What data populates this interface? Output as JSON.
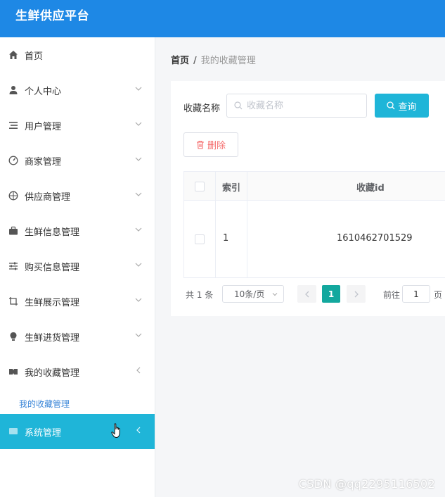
{
  "app": {
    "title": "生鲜供应平台"
  },
  "sidebar": {
    "items": [
      {
        "label": "首页",
        "icon": "home-icon",
        "chevron": ""
      },
      {
        "label": "个人中心",
        "icon": "user-icon",
        "chevron": "down"
      },
      {
        "label": "用户管理",
        "icon": "list-icon",
        "chevron": "down"
      },
      {
        "label": "商家管理",
        "icon": "compass-icon",
        "chevron": "down"
      },
      {
        "label": "供应商管理",
        "icon": "target-icon",
        "chevron": "down"
      },
      {
        "label": "生鲜信息管理",
        "icon": "briefcase-icon",
        "chevron": "down"
      },
      {
        "label": "购买信息管理",
        "icon": "sliders-icon",
        "chevron": "down"
      },
      {
        "label": "生鲜展示管理",
        "icon": "crop-icon",
        "chevron": "down"
      },
      {
        "label": "生鲜进货管理",
        "icon": "bulb-icon",
        "chevron": "down"
      },
      {
        "label": "我的收藏管理",
        "icon": "ticket-icon",
        "chevron": "left"
      }
    ],
    "sub_item": "我的收藏管理",
    "active_item": {
      "label": "系统管理",
      "icon": "system-icon"
    }
  },
  "breadcrumb": {
    "home": "首页",
    "separator": "/",
    "current": "我的收藏管理"
  },
  "search": {
    "label": "收藏名称",
    "placeholder": "收藏名称",
    "query_label": "查询"
  },
  "toolbar": {
    "delete_label": "删除"
  },
  "table": {
    "headers": [
      "索引",
      "收藏id"
    ],
    "rows": [
      {
        "index": "1",
        "id": "1610462701529"
      }
    ]
  },
  "pagination": {
    "total": "共 1 条",
    "page_size": "10条/页",
    "current_page": "1",
    "goto_label": "前往",
    "goto_value": "1",
    "page_suffix": "页"
  },
  "watermark": "CSDN @qq2295116502",
  "colors": {
    "header": "#1e88e5",
    "accent": "#1fb5d8",
    "page_active": "#13a89e",
    "danger": "#f56c6c"
  }
}
